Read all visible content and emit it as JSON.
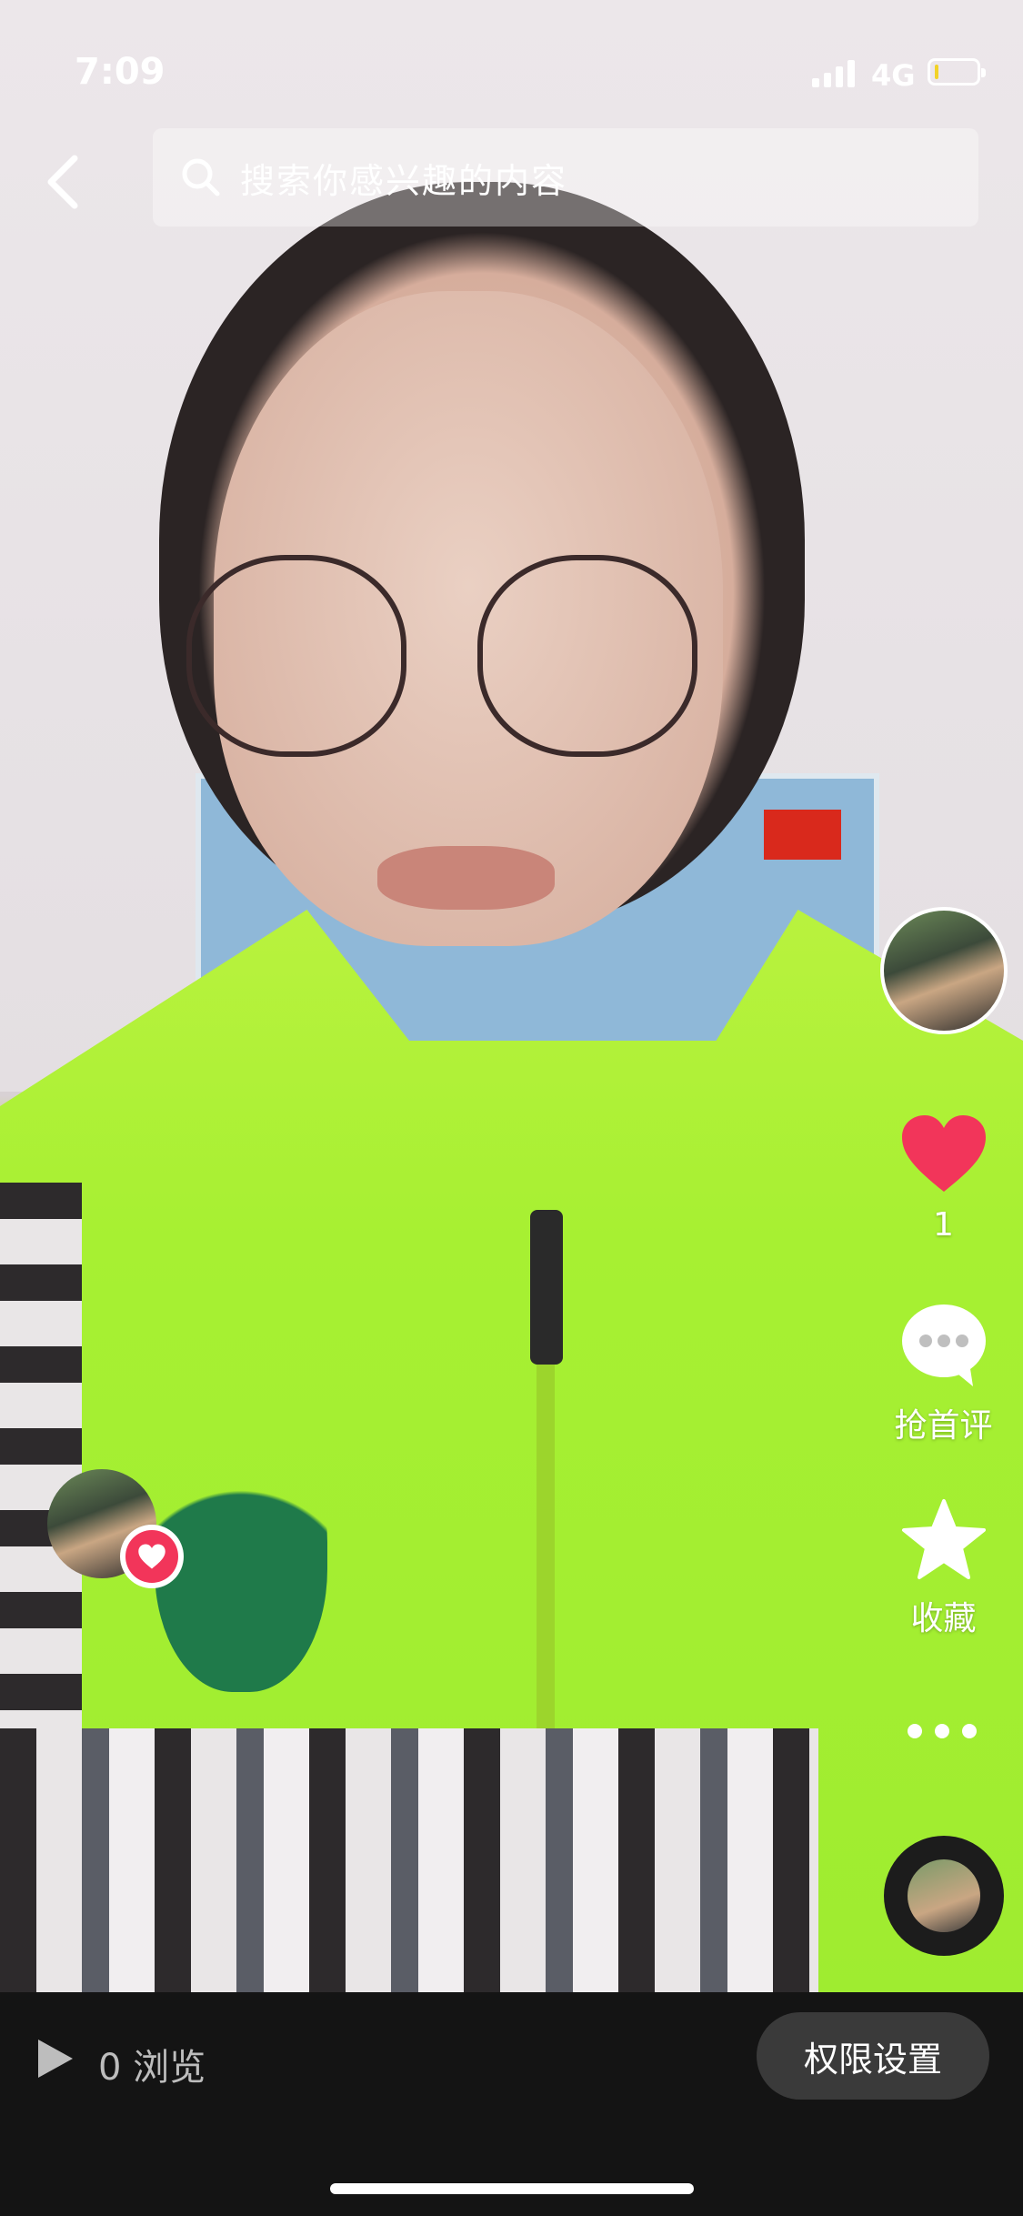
{
  "status_bar": {
    "time": "7:09",
    "network": "4G",
    "battery_level": 0.1
  },
  "top_bar": {
    "search_placeholder": "搜索你感兴趣的内容"
  },
  "right_rail": {
    "like_count": "1",
    "comment_label": "抢首评",
    "favorite_label": "收藏"
  },
  "bottom_bar": {
    "views": "0 浏览",
    "permission_button": "权限设置"
  },
  "colors": {
    "like_red": "#f2355a",
    "bottom_bg": "#141414",
    "button_bg": "#3a3a3a"
  },
  "icons": [
    "back-arrow-icon",
    "search-icon",
    "heart-icon",
    "comment-icon",
    "star-icon",
    "more-icon",
    "play-icon"
  ]
}
